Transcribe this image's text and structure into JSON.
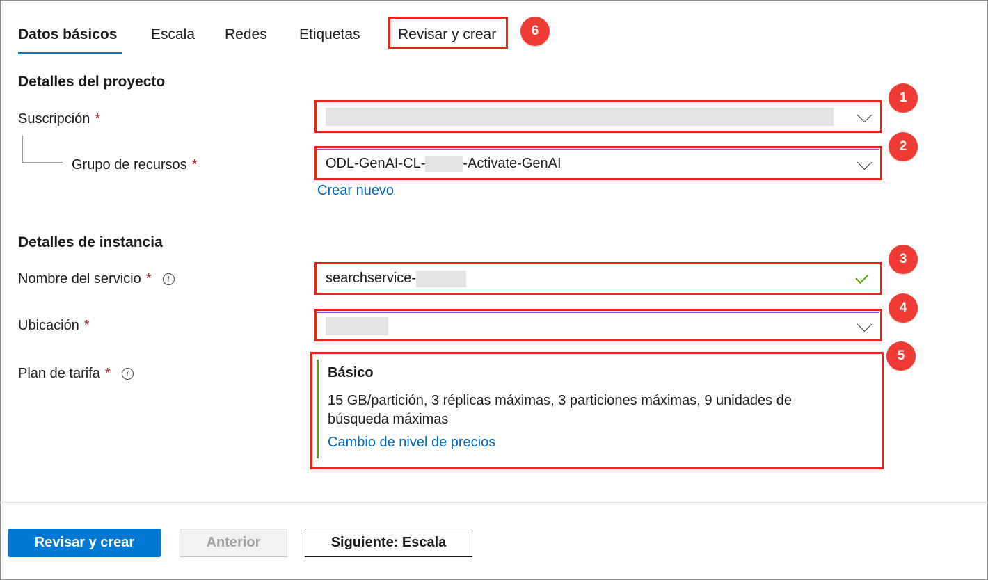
{
  "tabs": [
    {
      "label": "Datos básicos",
      "active": true
    },
    {
      "label": "Escala",
      "active": false
    },
    {
      "label": "Redes",
      "active": false
    },
    {
      "label": "Etiquetas",
      "active": false
    },
    {
      "label": "Revisar y crear",
      "active": false
    }
  ],
  "badges": [
    "1",
    "2",
    "3",
    "4",
    "5",
    "6"
  ],
  "project_details": {
    "heading": "Detalles del proyecto",
    "subscription_label": "Suscripción",
    "subscription_value": "",
    "resource_group_label": "Grupo de recursos",
    "resource_group_prefix": "ODL-GenAI-CL-",
    "resource_group_suffix": "-Activate-GenAI",
    "create_new_link": "Crear nuevo"
  },
  "instance_details": {
    "heading": "Detalles de instancia",
    "service_name_label": "Nombre del servicio",
    "service_name_value": "searchservice-",
    "location_label": "Ubicación",
    "location_value": "",
    "pricing_tier_label": "Plan de tarifa",
    "tier_name": "Básico",
    "tier_description": "15 GB/partición, 3 réplicas máximas, 3 particiones máximas, 9 unidades de búsqueda máximas",
    "change_tier_link": "Cambio de nivel de precios"
  },
  "required_marker": "*",
  "footer": {
    "review_create": "Revisar y crear",
    "previous": "Anterior",
    "next": "Siguiente: Escala"
  },
  "colors": {
    "accent": "#0078d4",
    "highlight": "#e8261a",
    "badge": "#ee3b33",
    "success": "#57a300",
    "required": "#a4262c"
  }
}
